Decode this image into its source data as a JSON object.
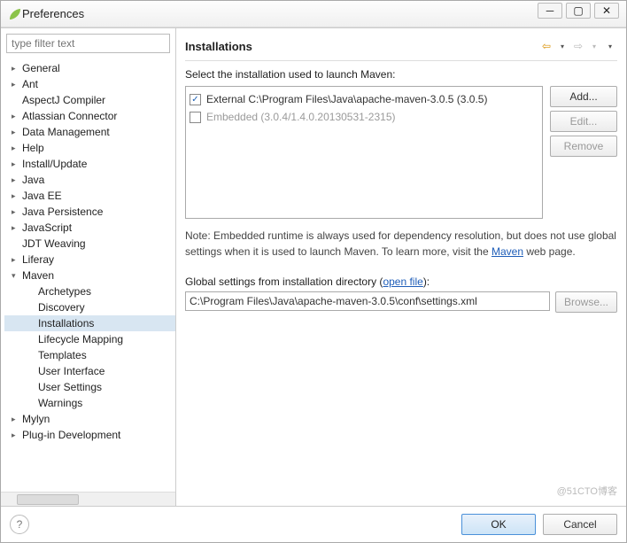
{
  "window": {
    "title": "Preferences"
  },
  "filter": {
    "placeholder": "type filter text"
  },
  "tree": {
    "items": [
      {
        "label": "General",
        "depth": 0,
        "expandable": true
      },
      {
        "label": "Ant",
        "depth": 0,
        "expandable": true
      },
      {
        "label": "AspectJ Compiler",
        "depth": 0,
        "expandable": false
      },
      {
        "label": "Atlassian Connector",
        "depth": 0,
        "expandable": true
      },
      {
        "label": "Data Management",
        "depth": 0,
        "expandable": true
      },
      {
        "label": "Help",
        "depth": 0,
        "expandable": true
      },
      {
        "label": "Install/Update",
        "depth": 0,
        "expandable": true
      },
      {
        "label": "Java",
        "depth": 0,
        "expandable": true
      },
      {
        "label": "Java EE",
        "depth": 0,
        "expandable": true
      },
      {
        "label": "Java Persistence",
        "depth": 0,
        "expandable": true
      },
      {
        "label": "JavaScript",
        "depth": 0,
        "expandable": true
      },
      {
        "label": "JDT Weaving",
        "depth": 0,
        "expandable": false
      },
      {
        "label": "Liferay",
        "depth": 0,
        "expandable": true
      },
      {
        "label": "Maven",
        "depth": 0,
        "expandable": true,
        "expanded": true
      },
      {
        "label": "Archetypes",
        "depth": 1,
        "expandable": false
      },
      {
        "label": "Discovery",
        "depth": 1,
        "expandable": false
      },
      {
        "label": "Installations",
        "depth": 1,
        "expandable": false,
        "selected": true
      },
      {
        "label": "Lifecycle Mapping",
        "depth": 1,
        "expandable": false
      },
      {
        "label": "Templates",
        "depth": 1,
        "expandable": false
      },
      {
        "label": "User Interface",
        "depth": 1,
        "expandable": false
      },
      {
        "label": "User Settings",
        "depth": 1,
        "expandable": false
      },
      {
        "label": "Warnings",
        "depth": 1,
        "expandable": false
      },
      {
        "label": "Mylyn",
        "depth": 0,
        "expandable": true
      },
      {
        "label": "Plug-in Development",
        "depth": 0,
        "expandable": true
      }
    ]
  },
  "page": {
    "heading": "Installations",
    "description": "Select the installation used to launch Maven:",
    "installations": [
      {
        "label": "External C:\\Program Files\\Java\\apache-maven-3.0.5 (3.0.5)",
        "checked": true,
        "enabled": true
      },
      {
        "label": "Embedded (3.0.4/1.4.0.20130531-2315)",
        "checked": false,
        "enabled": false
      }
    ],
    "buttons": {
      "add": "Add...",
      "edit": "Edit...",
      "remove": "Remove"
    },
    "note_prefix": "Note: Embedded runtime is always used for dependency resolution, but does not use global settings when it is used to launch Maven. To learn more, visit the ",
    "note_link": "Maven",
    "note_suffix": " web page.",
    "global_label_prefix": "Global settings from installation directory (",
    "global_link": "open file",
    "global_label_suffix": "):",
    "path": "C:\\Program Files\\Java\\apache-maven-3.0.5\\conf\\settings.xml",
    "browse": "Browse..."
  },
  "footer": {
    "ok": "OK",
    "cancel": "Cancel"
  },
  "watermark": "@51CTO博客"
}
